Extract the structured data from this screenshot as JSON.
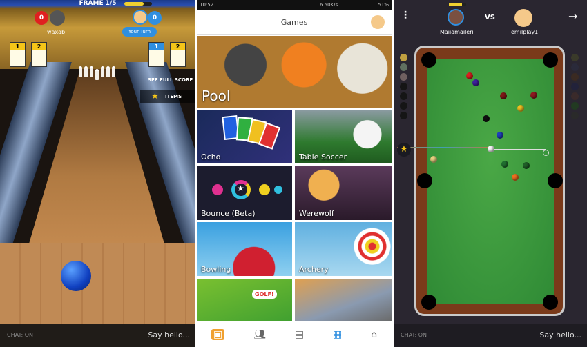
{
  "bowling": {
    "frame": "FRAME 1/5",
    "player1": {
      "name": "waxab",
      "score": "0",
      "frames": [
        "1",
        "2"
      ]
    },
    "player2": {
      "score": "0",
      "turn_label": "Your Turn",
      "frames": [
        "1",
        "2"
      ]
    },
    "see_full_score": "SEE FULL SCORE",
    "items": "ITEMS",
    "chat_status": "CHAT: ON",
    "chat_placeholder": "Say hello..."
  },
  "games": {
    "status_bar": {
      "time": "10:52",
      "network": "6.50K/s",
      "battery": "51%"
    },
    "title": "Games",
    "tiles": [
      {
        "label": "Pool"
      },
      {
        "label": "Ocho"
      },
      {
        "label": "Table Soccer"
      },
      {
        "label": "Bounce (Beta)"
      },
      {
        "label": "Werewolf"
      },
      {
        "label": "Bowling"
      },
      {
        "label": "Archery"
      },
      {
        "label": "GOLF!"
      },
      {
        "label": ""
      }
    ],
    "nav": [
      {
        "icon": "treasure-chest-icon"
      },
      {
        "icon": "friends-icon"
      },
      {
        "icon": "chat-icon"
      },
      {
        "icon": "games-icon",
        "active": true
      },
      {
        "icon": "home-icon"
      }
    ],
    "accent": "#2f8fe0"
  },
  "pool": {
    "player1": "Maiiamaileri",
    "vs": "VS",
    "player2": "emilplay1",
    "chat_status": "CHAT: ON",
    "chat_placeholder": "Say hello..."
  }
}
